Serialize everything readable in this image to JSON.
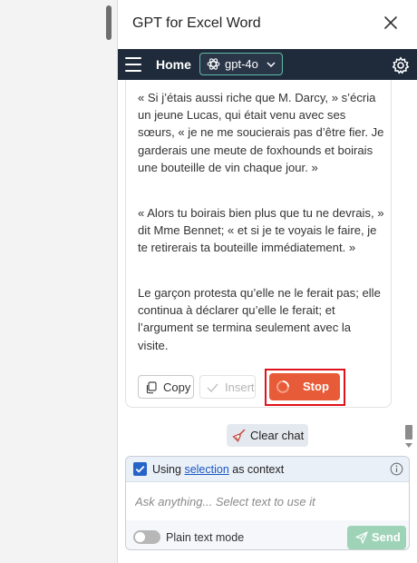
{
  "pane": {
    "title": "GPT for Excel Word"
  },
  "header": {
    "home_label": "Home",
    "model_label": "gpt-4o"
  },
  "message": {
    "paragraphs": [
      "« Si j’étais aussi riche que M. Darcy, » s’écria un jeune Lucas, qui était venu avec ses sœurs, « je ne me soucierais pas d’être fier. Je garderais une meute de foxhounds et boirais une bouteille de vin chaque jour. »",
      "« Alors tu boirais bien plus que tu ne devrais, » dit Mme Bennet; « et si je te voyais le faire, je te retirerais ta bouteille immédiatement. »",
      "Le garçon protesta qu’elle ne le ferait pas; elle continua à déclarer qu’elle le ferait; et l’argument se termina seulement avec la visite."
    ],
    "actions": {
      "copy": "Copy",
      "insert": "Insert",
      "stop": "Stop"
    }
  },
  "clear_chat": "Clear chat",
  "composer": {
    "context_prefix": "Using ",
    "context_link": "selection",
    "context_suffix": " as context",
    "context_checked": true,
    "placeholder": "Ask anything... Select text to use it",
    "plain_text_label": "Plain text mode",
    "plain_text_on": false,
    "send": "Send"
  },
  "colors": {
    "header_bg": "#1f2b3b",
    "stop_bg": "#e85b38",
    "highlight": "#e0121c",
    "send_bg": "#9fd3b8",
    "check_bg": "#2563c9"
  }
}
